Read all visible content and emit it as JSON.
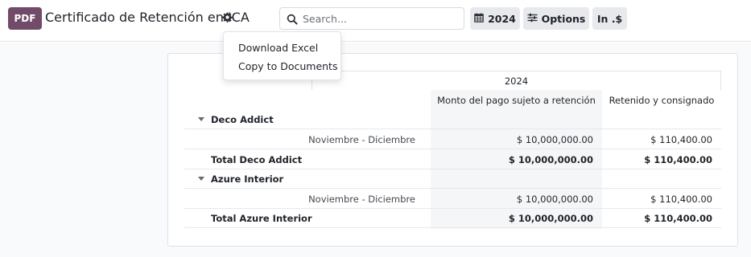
{
  "header": {
    "pdf_label": "PDF",
    "title": "Certificado de Retención en ICA"
  },
  "search": {
    "placeholder": "Search...",
    "value": ""
  },
  "toolbar": {
    "year_label": "2024",
    "options_label": "Options",
    "currency_label": "In .$"
  },
  "dropdown": {
    "items": [
      "Download Excel",
      "Copy to Documents"
    ]
  },
  "report": {
    "year": "2024",
    "columns": [
      "Monto del pago sujeto a retención",
      "Retenido y consignado"
    ],
    "groups": [
      {
        "name": "Deco Addict",
        "line_label": "Noviembre - Diciembre",
        "line_values": [
          "$ 10,000,000.00",
          "$ 110,400.00"
        ],
        "total_label": "Total Deco Addict",
        "total_values": [
          "$ 10,000,000.00",
          "$ 110,400.00"
        ]
      },
      {
        "name": "Azure Interior",
        "line_label": "Noviembre - Diciembre",
        "line_values": [
          "$ 10,000,000.00",
          "$ 110,400.00"
        ],
        "total_label": "Total Azure Interior",
        "total_values": [
          "$ 10,000,000.00",
          "$ 110,400.00"
        ]
      }
    ]
  },
  "colors": {
    "accent": "#714b67",
    "button_bg": "#e7e9ed"
  }
}
